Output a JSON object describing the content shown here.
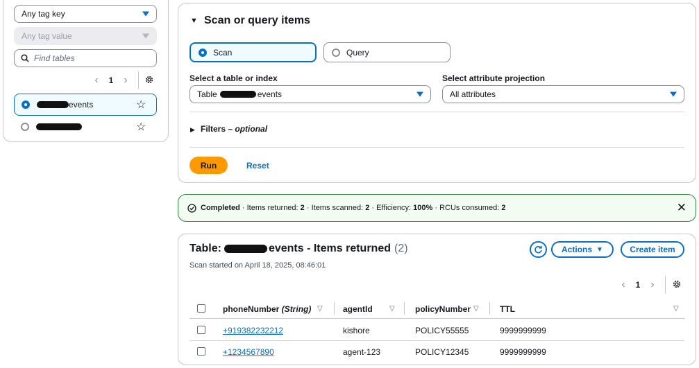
{
  "filters": {
    "tag_key": "Any tag key",
    "tag_value": "Any tag value",
    "search_placeholder": "Find tables",
    "page": "1"
  },
  "tables": [
    {
      "name_suffix": "events",
      "selected": true
    },
    {
      "name_suffix": "",
      "selected": false
    }
  ],
  "scan_panel": {
    "title": "Scan or query items",
    "scan_label": "Scan",
    "query_label": "Query",
    "table_label": "Select a table or index",
    "table_value_prefix": "Table",
    "table_value_suffix": "events",
    "projection_label": "Select attribute projection",
    "projection_value": "All attributes",
    "filters_label": "Filters",
    "filters_optional": "optional",
    "run_label": "Run",
    "reset_label": "Reset"
  },
  "status": {
    "completed": "Completed",
    "items_returned_label": "Items returned:",
    "items_returned": "2",
    "items_scanned_label": "Items scanned:",
    "items_scanned": "2",
    "efficiency_label": "Efficiency:",
    "efficiency": "100%",
    "rcus_label": "RCUs consumed:",
    "rcus": "2"
  },
  "results": {
    "title_prefix": "Table:",
    "title_suffix": "events - Items returned",
    "count": "(2)",
    "scan_started": "Scan started on April 18, 2025, 08:46:01",
    "actions_label": "Actions",
    "create_label": "Create item",
    "page": "1",
    "columns": [
      "phoneNumber",
      "(String)",
      "agentId",
      "policyNumber",
      "TTL"
    ],
    "rows": [
      [
        "+919382232212",
        "kishore",
        "POLICY55555",
        "9999999999"
      ],
      [
        "+1234567890",
        "agent-123",
        "POLICY12345",
        "9999999999"
      ]
    ]
  },
  "colors": {
    "accent": "#0b6ec5",
    "run": "#ff9900",
    "success": "#2e8540"
  }
}
